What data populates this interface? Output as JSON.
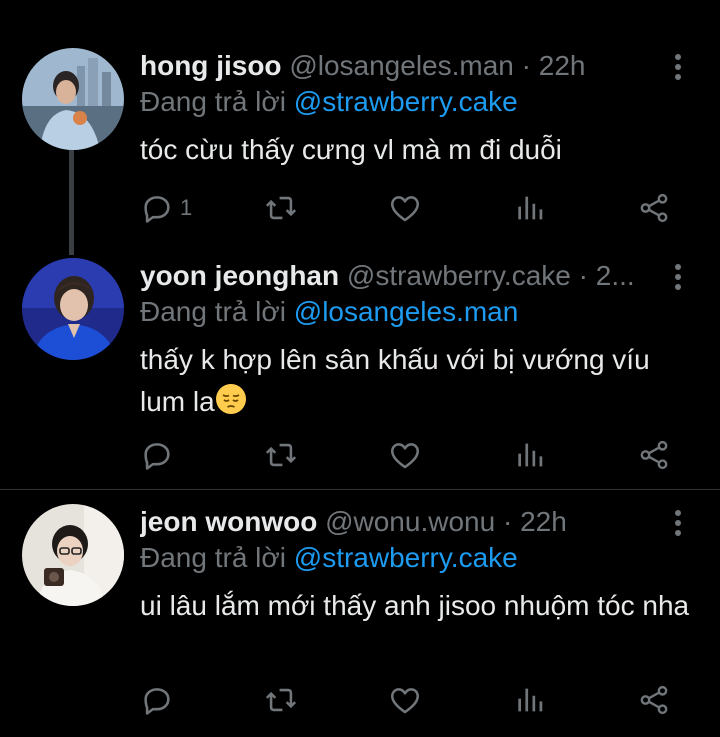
{
  "tweets": [
    {
      "name": "hong jisoo",
      "handle": "@losangeles.man",
      "dot": "·",
      "time": "22h",
      "reply_prefix": "Đang trả lời",
      "reply_to": "@strawberry.cake",
      "text": "tóc cừu thấy cưng vl mà m đi duỗi",
      "reply_count": "1"
    },
    {
      "name": "yoon jeonghan",
      "handle": "@strawberry.cake",
      "dot": "·",
      "time": "2...",
      "reply_prefix": "Đang trả lời",
      "reply_to": "@losangeles.man",
      "text_line1": "thấy k hợp lên sân khấu với bị vướng víu",
      "text_line2": "lum la",
      "emoji": "pensive-face-emoji",
      "reply_count": ""
    },
    {
      "name": "jeon wonwoo",
      "handle": "@wonu.wonu",
      "dot": "·",
      "time": "22h",
      "reply_prefix": "Đang trả lời",
      "reply_to": "@strawberry.cake",
      "text": "ui lâu lắm mới thấy anh jisoo nhuộm tóc nha",
      "reply_count": ""
    }
  ],
  "icons": {
    "reply": "reply-icon",
    "retweet": "retweet-icon",
    "like": "like-icon",
    "views": "views-icon",
    "share": "share-icon",
    "more": "more-icon"
  },
  "colors": {
    "background": "#000000",
    "text": "#e7e9ea",
    "muted": "#71767b",
    "mention": "#1d9bf0",
    "thread_line": "#3a3d41"
  }
}
